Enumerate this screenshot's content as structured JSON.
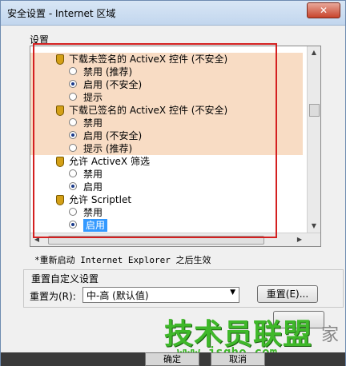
{
  "window": {
    "title": "安全设置 - Internet 区域",
    "close_label": "✕"
  },
  "settings_label": "设置",
  "list_rows": [
    {
      "kind": "head",
      "label": "下载未签名的 ActiveX 控件 (不安全)",
      "hl": true
    },
    {
      "kind": "opt",
      "label": "禁用 (推荐)",
      "checked": false,
      "hl": true
    },
    {
      "kind": "opt",
      "label": "启用 (不安全)",
      "checked": true,
      "hl": true
    },
    {
      "kind": "opt",
      "label": "提示",
      "checked": false,
      "hl": true
    },
    {
      "kind": "head",
      "label": "下载已签名的 ActiveX 控件 (不安全)",
      "hl": true
    },
    {
      "kind": "opt",
      "label": "禁用",
      "checked": false,
      "hl": true
    },
    {
      "kind": "opt",
      "label": "启用 (不安全)",
      "checked": true,
      "hl": true
    },
    {
      "kind": "opt",
      "label": "提示 (推荐)",
      "checked": false,
      "hl": true
    },
    {
      "kind": "head",
      "label": "允许 ActiveX 筛选",
      "hl": false
    },
    {
      "kind": "opt",
      "label": "禁用",
      "checked": false,
      "hl": false
    },
    {
      "kind": "opt",
      "label": "启用",
      "checked": true,
      "hl": false
    },
    {
      "kind": "head",
      "label": "允许 Scriptlet",
      "hl": false
    },
    {
      "kind": "opt",
      "label": "禁用",
      "checked": false,
      "hl": false
    },
    {
      "kind": "opt",
      "label": "启用",
      "checked": true,
      "hl": false,
      "selected": true
    }
  ],
  "restart_note": "*重新启动 Internet Explorer 之后生效",
  "reset": {
    "group_title": "重置自定义设置",
    "reset_to_label": "重置为(R):",
    "level_value": "中-高 (默认值)",
    "reset_button": "重置(E)..."
  },
  "watermark": {
    "text": "技术员联盟",
    "url": "www.jsgho.com",
    "suffix": "家"
  },
  "bottom_buttons": [
    "确定",
    "取消"
  ],
  "accent": {
    "highlight": "#f8dcc4",
    "selection": "#3399ff",
    "annotation": "#d42020",
    "watermark": "#3fb82a"
  }
}
